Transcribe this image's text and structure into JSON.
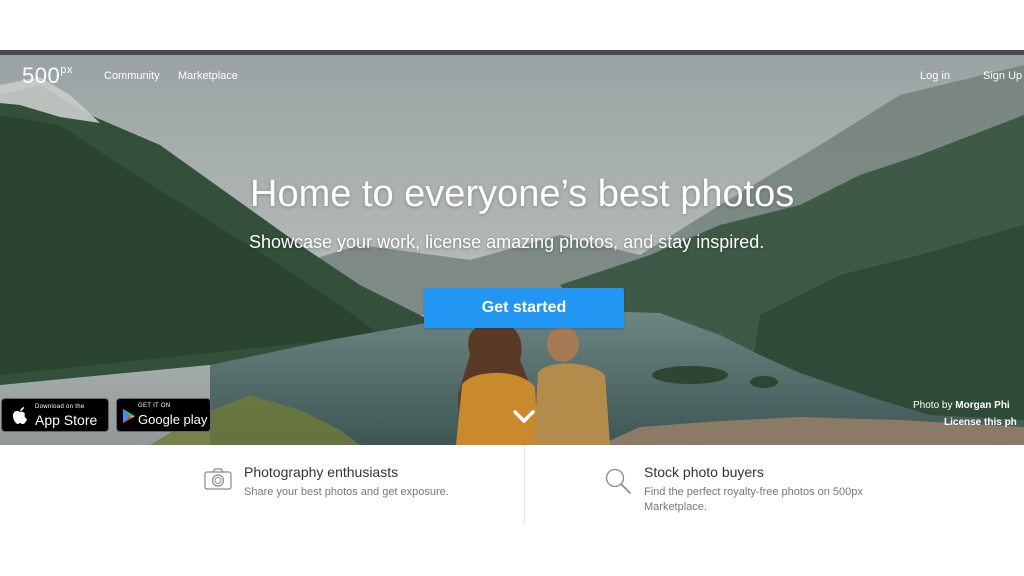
{
  "nav": {
    "logo_main": "500",
    "logo_sup": "px",
    "community": "Community",
    "marketplace": "Marketplace",
    "login": "Log in",
    "signup": "Sign Up"
  },
  "hero": {
    "headline": "Home to everyone’s best photos",
    "subline": "Showcase your work, license amazing photos, and stay inspired.",
    "cta": "Get started",
    "credit_prefix": "Photo by",
    "credit_name": "Morgan Phi",
    "license": "License this ph"
  },
  "stores": {
    "apple_small": "Download on the",
    "apple_big": "App Store",
    "google_small": "GET IT ON",
    "google_big": "Google play"
  },
  "features": [
    {
      "title": "Photography enthusiasts",
      "desc": "Share your best photos and get exposure."
    },
    {
      "title": "Stock photo buyers",
      "desc": "Find the perfect royalty-free photos on 500px Marketplace."
    }
  ],
  "icons": {
    "camera": "camera-icon",
    "search": "search-icon",
    "apple": "apple-icon",
    "google_play": "google-play-icon",
    "chevron": "chevron-down-icon"
  },
  "colors": {
    "cta": "#2196f3"
  }
}
